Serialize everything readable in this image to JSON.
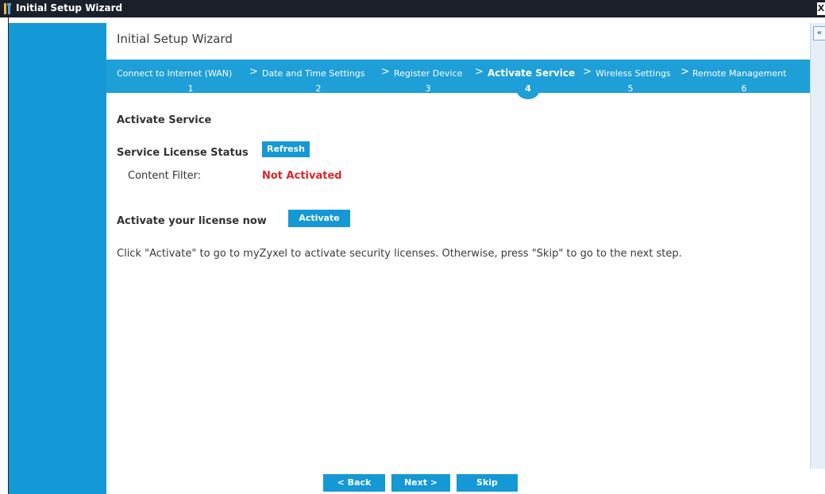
{
  "window": {
    "title": "Initial Setup Wizard",
    "close_glyph": "X"
  },
  "wizard": {
    "title": "Initial Setup Wizard",
    "collapse_glyph": "«"
  },
  "steps": [
    {
      "label": "Connect to Internet (WAN)",
      "number": "1",
      "active": false
    },
    {
      "label": "Date and Time Settings",
      "number": "2",
      "active": false
    },
    {
      "label": "Register Device",
      "number": "3",
      "active": false
    },
    {
      "label": "Activate Service",
      "number": "4",
      "active": true
    },
    {
      "label": "Wireless Settings",
      "number": "5",
      "active": false
    },
    {
      "label": "Remote Management",
      "number": "6",
      "active": false
    }
  ],
  "step_separator": ">",
  "content": {
    "section_title": "Activate Service",
    "license_status_title": "Service License Status",
    "refresh_label": "Refresh",
    "content_filter_label": "Content Filter:",
    "content_filter_status": "Not Activated",
    "activate_prompt": "Activate your license now",
    "activate_label": "Activate",
    "help_text": "Click \"Activate\" to go to myZyxel to activate security licenses. Otherwise, press \"Skip\" to go to the next step."
  },
  "footer": {
    "back_label": "< Back",
    "next_label": "Next >",
    "skip_label": "Skip"
  },
  "colors": {
    "accent": "#1598d6",
    "step_bar": "#1e9fd8",
    "titlebar": "#1b1f2a",
    "error": "#d8262b"
  }
}
